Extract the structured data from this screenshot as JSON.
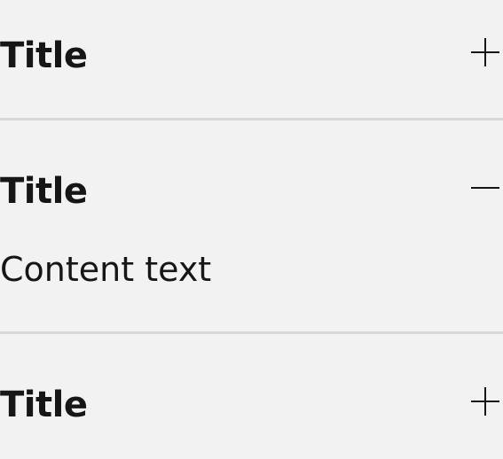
{
  "accordion": {
    "items": [
      {
        "title": "Title",
        "state": "collapsed",
        "icon": "plus-icon"
      },
      {
        "title": "Title",
        "state": "expanded",
        "icon": "minus-icon",
        "content": "Content text"
      },
      {
        "title": "Title",
        "state": "collapsed",
        "icon": "plus-icon"
      }
    ],
    "colors": {
      "background": "#f2f2f2",
      "text": "#161616",
      "divider": "#d8d8d8"
    }
  }
}
